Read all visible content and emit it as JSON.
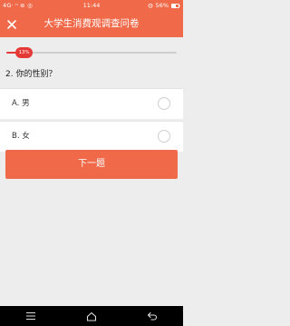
{
  "status_bar": {
    "left_indicators": "4G· ⁿ ⊜ ◎",
    "time": "11:44",
    "battery_text": "56%",
    "battery_level": 0.56,
    "bg_color": "#f06a4a"
  },
  "app_bar": {
    "title": "大学生消费观调查问卷",
    "close_icon": "close-icon",
    "bg_color": "#f06a4a"
  },
  "progress": {
    "percent_text": "13%",
    "percent_value": 13,
    "bar_color": "#e53935"
  },
  "question": {
    "text": "2. 你的性别？"
  },
  "options": [
    {
      "label": "A. 男",
      "selected": false
    },
    {
      "label": "B. 女",
      "selected": false
    }
  ],
  "next_button": {
    "label": "下一题",
    "bg_color": "#f06a4a"
  },
  "nav_bar": {
    "icons": [
      "menu-icon",
      "home-icon",
      "back-icon"
    ]
  }
}
